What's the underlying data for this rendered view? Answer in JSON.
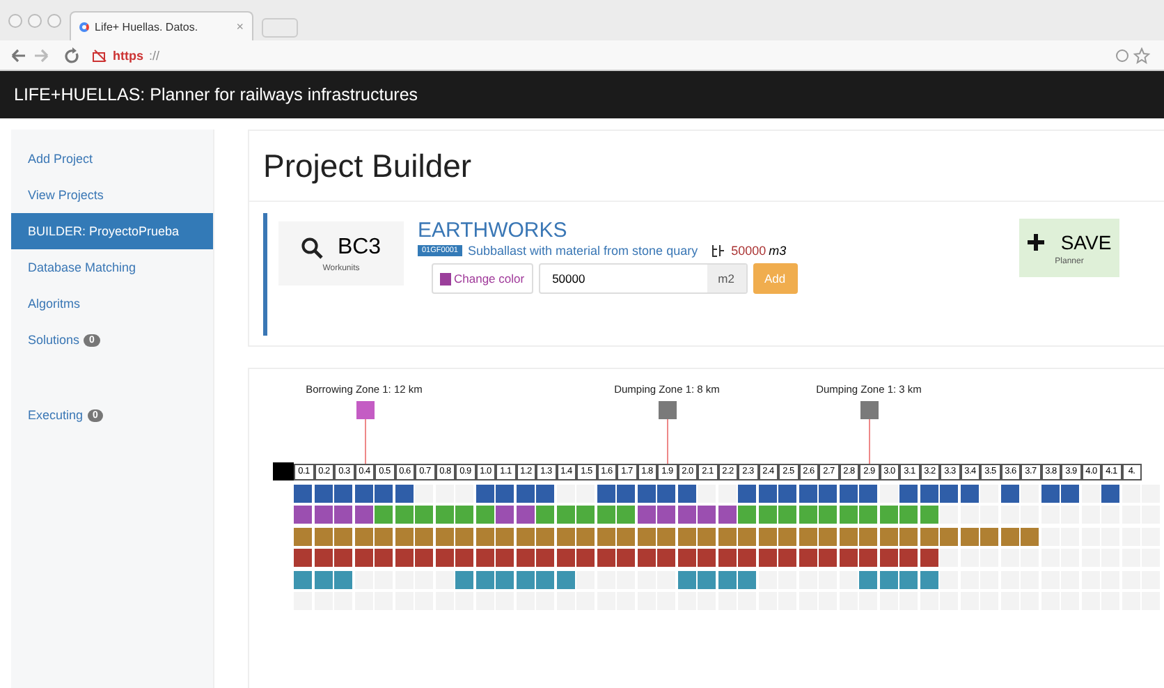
{
  "browser": {
    "tab_title": "Life+ Huellas. Datos.",
    "tab_close": "×",
    "url_scheme": "https",
    "url_rest": "://"
  },
  "navbar": {
    "title": "LIFE+HUELLAS: Planner for railways infrastructures"
  },
  "sidebar": {
    "items": [
      {
        "label": "Add Project",
        "selected": false
      },
      {
        "label": "View Projects",
        "selected": false
      },
      {
        "label": "BUILDER: ProyectoPrueba",
        "selected": true
      },
      {
        "label": "Database Matching",
        "selected": false
      },
      {
        "label": "Algoritms",
        "selected": false
      },
      {
        "label": "Solutions",
        "badge": "0",
        "selected": false
      },
      {
        "label": "Executing",
        "badge": "0",
        "selected": false,
        "separated": true
      }
    ]
  },
  "page": {
    "title": "Project Builder"
  },
  "workunit": {
    "code": "BC3",
    "caption": "Workunits",
    "category": "EARTHWORKS",
    "badge": "01GF0001",
    "description": "Subballast with material from stone quary",
    "quantity": "50000",
    "quantity_unit": "m3",
    "color": "#9b3f9b",
    "change_color": "Change color",
    "input_value": "50000",
    "input_unit": "m2",
    "add": "Add",
    "save": "SAVE",
    "save_caption": "Planner"
  },
  "timeline": {
    "labels": [
      {
        "text": "0.1"
      },
      {
        "text": "0.2"
      },
      {
        "text": "0.3"
      },
      {
        "text": "0.4",
        "marker": {
          "label": "Borrowing Zone 1: 12 km",
          "color": "#c45cc4"
        }
      },
      {
        "text": "0.5"
      },
      {
        "text": "0.6"
      },
      {
        "text": "0.7"
      },
      {
        "text": "0.8"
      },
      {
        "text": "0.9"
      },
      {
        "text": "1.0"
      },
      {
        "text": "1.1"
      },
      {
        "text": "1.2"
      },
      {
        "text": "1.3"
      },
      {
        "text": "1.4"
      },
      {
        "text": "1.5"
      },
      {
        "text": "1.6"
      },
      {
        "text": "1.7"
      },
      {
        "text": "1.8"
      },
      {
        "text": "1.9",
        "marker": {
          "label": "Dumping Zone 1: 8 km",
          "color": "#7a7a7a"
        }
      },
      {
        "text": "2.0"
      },
      {
        "text": "2.1"
      },
      {
        "text": "2.2"
      },
      {
        "text": "2.3"
      },
      {
        "text": "2.4"
      },
      {
        "text": "2.5"
      },
      {
        "text": "2.6"
      },
      {
        "text": "2.7"
      },
      {
        "text": "2.8"
      },
      {
        "text": "2.9",
        "marker": {
          "label": "Dumping Zone 1: 3 km",
          "color": "#7a7a7a"
        }
      },
      {
        "text": "3.0"
      },
      {
        "text": "3.1"
      },
      {
        "text": "3.2"
      },
      {
        "text": "3.3"
      },
      {
        "text": "3.4"
      },
      {
        "text": "3.5"
      },
      {
        "text": "3.6"
      },
      {
        "text": "3.7"
      },
      {
        "text": "3.8"
      },
      {
        "text": "3.9"
      },
      {
        "text": "4.0"
      },
      {
        "text": "4.1"
      },
      {
        "text": "4."
      }
    ],
    "rows": [
      {
        "cells": [
          {
            "filled": true,
            "color": "#2f5ea8"
          },
          {
            "filled": true,
            "color": "#2f5ea8"
          },
          {
            "filled": true,
            "color": "#2f5ea8"
          },
          {
            "filled": true,
            "color": "#2f5ea8"
          },
          {
            "filled": true,
            "color": "#2f5ea8"
          },
          {
            "filled": true,
            "color": "#2f5ea8"
          },
          {
            "filled": false
          },
          {
            "filled": false
          },
          {
            "filled": false
          },
          {
            "filled": true,
            "color": "#2f5ea8"
          },
          {
            "filled": true,
            "color": "#2f5ea8"
          },
          {
            "filled": true,
            "color": "#2f5ea8"
          },
          {
            "filled": true,
            "color": "#2f5ea8"
          },
          {
            "filled": false
          },
          {
            "filled": false
          },
          {
            "filled": true,
            "color": "#2f5ea8"
          },
          {
            "filled": true,
            "color": "#2f5ea8"
          },
          {
            "filled": true,
            "color": "#2f5ea8"
          },
          {
            "filled": true,
            "color": "#2f5ea8"
          },
          {
            "filled": true,
            "color": "#2f5ea8"
          },
          {
            "filled": false
          },
          {
            "filled": false
          },
          {
            "filled": true,
            "color": "#2f5ea8"
          },
          {
            "filled": true,
            "color": "#2f5ea8"
          },
          {
            "filled": true,
            "color": "#2f5ea8"
          },
          {
            "filled": true,
            "color": "#2f5ea8"
          },
          {
            "filled": true,
            "color": "#2f5ea8"
          },
          {
            "filled": true,
            "color": "#2f5ea8"
          },
          {
            "filled": true,
            "color": "#2f5ea8"
          },
          {
            "filled": false
          },
          {
            "filled": true,
            "color": "#2f5ea8"
          },
          {
            "filled": true,
            "color": "#2f5ea8"
          },
          {
            "filled": true,
            "color": "#2f5ea8"
          },
          {
            "filled": true,
            "color": "#2f5ea8"
          },
          {
            "filled": false
          },
          {
            "filled": true,
            "color": "#2f5ea8"
          },
          {
            "filled": false
          },
          {
            "filled": true,
            "color": "#2f5ea8"
          },
          {
            "filled": true,
            "color": "#2f5ea8"
          },
          {
            "filled": false
          },
          {
            "filled": true,
            "color": "#2f5ea8"
          },
          {
            "filled": false
          },
          {
            "filled": false
          }
        ]
      },
      {
        "cells": [
          {
            "filled": true,
            "color": "#9b4fb0"
          },
          {
            "filled": true,
            "color": "#9b4fb0"
          },
          {
            "filled": true,
            "color": "#9b4fb0"
          },
          {
            "filled": true,
            "color": "#9b4fb0"
          },
          {
            "filled": true,
            "color": "#4eac3e"
          },
          {
            "filled": true,
            "color": "#4eac3e"
          },
          {
            "filled": true,
            "color": "#4eac3e"
          },
          {
            "filled": true,
            "color": "#4eac3e"
          },
          {
            "filled": true,
            "color": "#4eac3e"
          },
          {
            "filled": true,
            "color": "#4eac3e"
          },
          {
            "filled": true,
            "color": "#9b4fb0"
          },
          {
            "filled": true,
            "color": "#9b4fb0"
          },
          {
            "filled": true,
            "color": "#4eac3e"
          },
          {
            "filled": true,
            "color": "#4eac3e"
          },
          {
            "filled": true,
            "color": "#4eac3e"
          },
          {
            "filled": true,
            "color": "#4eac3e"
          },
          {
            "filled": true,
            "color": "#4eac3e"
          },
          {
            "filled": true,
            "color": "#9b4fb0"
          },
          {
            "filled": true,
            "color": "#9b4fb0"
          },
          {
            "filled": true,
            "color": "#9b4fb0"
          },
          {
            "filled": true,
            "color": "#9b4fb0"
          },
          {
            "filled": true,
            "color": "#9b4fb0"
          },
          {
            "filled": true,
            "color": "#4eac3e"
          },
          {
            "filled": true,
            "color": "#4eac3e"
          },
          {
            "filled": true,
            "color": "#4eac3e"
          },
          {
            "filled": true,
            "color": "#4eac3e"
          },
          {
            "filled": true,
            "color": "#4eac3e"
          },
          {
            "filled": true,
            "color": "#4eac3e"
          },
          {
            "filled": true,
            "color": "#4eac3e"
          },
          {
            "filled": true,
            "color": "#4eac3e"
          },
          {
            "filled": true,
            "color": "#4eac3e"
          },
          {
            "filled": true,
            "color": "#4eac3e"
          },
          {
            "filled": false
          },
          {
            "filled": false
          },
          {
            "filled": false
          },
          {
            "filled": false
          },
          {
            "filled": false
          },
          {
            "filled": false
          },
          {
            "filled": false
          },
          {
            "filled": false
          },
          {
            "filled": false
          },
          {
            "filled": false
          },
          {
            "filled": false
          }
        ]
      },
      {
        "cells": [
          {
            "filled": true,
            "color": "#b08032"
          },
          {
            "filled": true,
            "color": "#b08032"
          },
          {
            "filled": true,
            "color": "#b08032"
          },
          {
            "filled": true,
            "color": "#b08032"
          },
          {
            "filled": true,
            "color": "#b08032"
          },
          {
            "filled": true,
            "color": "#b08032"
          },
          {
            "filled": true,
            "color": "#b08032"
          },
          {
            "filled": true,
            "color": "#b08032"
          },
          {
            "filled": true,
            "color": "#b08032"
          },
          {
            "filled": true,
            "color": "#b08032"
          },
          {
            "filled": true,
            "color": "#b08032"
          },
          {
            "filled": true,
            "color": "#b08032"
          },
          {
            "filled": true,
            "color": "#b08032"
          },
          {
            "filled": true,
            "color": "#b08032"
          },
          {
            "filled": true,
            "color": "#b08032"
          },
          {
            "filled": true,
            "color": "#b08032"
          },
          {
            "filled": true,
            "color": "#b08032"
          },
          {
            "filled": true,
            "color": "#b08032"
          },
          {
            "filled": true,
            "color": "#b08032"
          },
          {
            "filled": true,
            "color": "#b08032"
          },
          {
            "filled": true,
            "color": "#b08032"
          },
          {
            "filled": true,
            "color": "#b08032"
          },
          {
            "filled": true,
            "color": "#b08032"
          },
          {
            "filled": true,
            "color": "#b08032"
          },
          {
            "filled": true,
            "color": "#b08032"
          },
          {
            "filled": true,
            "color": "#b08032"
          },
          {
            "filled": true,
            "color": "#b08032"
          },
          {
            "filled": true,
            "color": "#b08032"
          },
          {
            "filled": true,
            "color": "#b08032"
          },
          {
            "filled": true,
            "color": "#b08032"
          },
          {
            "filled": true,
            "color": "#b08032"
          },
          {
            "filled": true,
            "color": "#b08032"
          },
          {
            "filled": true,
            "color": "#b08032"
          },
          {
            "filled": true,
            "color": "#b08032"
          },
          {
            "filled": true,
            "color": "#b08032"
          },
          {
            "filled": true,
            "color": "#b08032"
          },
          {
            "filled": true,
            "color": "#b08032"
          },
          {
            "filled": false
          },
          {
            "filled": false
          },
          {
            "filled": false
          },
          {
            "filled": false
          },
          {
            "filled": false
          },
          {
            "filled": false
          }
        ]
      },
      {
        "cells": [
          {
            "filled": true,
            "color": "#ad3a31"
          },
          {
            "filled": true,
            "color": "#ad3a31"
          },
          {
            "filled": true,
            "color": "#ad3a31"
          },
          {
            "filled": true,
            "color": "#ad3a31"
          },
          {
            "filled": true,
            "color": "#ad3a31"
          },
          {
            "filled": true,
            "color": "#ad3a31"
          },
          {
            "filled": true,
            "color": "#ad3a31"
          },
          {
            "filled": true,
            "color": "#ad3a31"
          },
          {
            "filled": true,
            "color": "#ad3a31"
          },
          {
            "filled": true,
            "color": "#ad3a31"
          },
          {
            "filled": true,
            "color": "#ad3a31"
          },
          {
            "filled": true,
            "color": "#ad3a31"
          },
          {
            "filled": true,
            "color": "#ad3a31"
          },
          {
            "filled": true,
            "color": "#ad3a31"
          },
          {
            "filled": true,
            "color": "#ad3a31"
          },
          {
            "filled": true,
            "color": "#ad3a31"
          },
          {
            "filled": true,
            "color": "#ad3a31"
          },
          {
            "filled": true,
            "color": "#ad3a31"
          },
          {
            "filled": true,
            "color": "#ad3a31"
          },
          {
            "filled": true,
            "color": "#ad3a31"
          },
          {
            "filled": true,
            "color": "#ad3a31"
          },
          {
            "filled": true,
            "color": "#ad3a31"
          },
          {
            "filled": true,
            "color": "#ad3a31"
          },
          {
            "filled": true,
            "color": "#ad3a31"
          },
          {
            "filled": true,
            "color": "#ad3a31"
          },
          {
            "filled": true,
            "color": "#ad3a31"
          },
          {
            "filled": true,
            "color": "#ad3a31"
          },
          {
            "filled": true,
            "color": "#ad3a31"
          },
          {
            "filled": true,
            "color": "#ad3a31"
          },
          {
            "filled": true,
            "color": "#ad3a31"
          },
          {
            "filled": true,
            "color": "#ad3a31"
          },
          {
            "filled": true,
            "color": "#ad3a31"
          },
          {
            "filled": false
          },
          {
            "filled": false
          },
          {
            "filled": false
          },
          {
            "filled": false
          },
          {
            "filled": false
          },
          {
            "filled": false
          },
          {
            "filled": false
          },
          {
            "filled": false
          },
          {
            "filled": false
          },
          {
            "filled": false
          },
          {
            "filled": false
          }
        ]
      },
      {
        "cells": [
          {
            "filled": true,
            "color": "#3d95b0"
          },
          {
            "filled": true,
            "color": "#3d95b0"
          },
          {
            "filled": true,
            "color": "#3d95b0"
          },
          {
            "filled": false
          },
          {
            "filled": false
          },
          {
            "filled": false
          },
          {
            "filled": false
          },
          {
            "filled": false
          },
          {
            "filled": true,
            "color": "#3d95b0"
          },
          {
            "filled": true,
            "color": "#3d95b0"
          },
          {
            "filled": true,
            "color": "#3d95b0"
          },
          {
            "filled": true,
            "color": "#3d95b0"
          },
          {
            "filled": true,
            "color": "#3d95b0"
          },
          {
            "filled": true,
            "color": "#3d95b0"
          },
          {
            "filled": false
          },
          {
            "filled": false
          },
          {
            "filled": false
          },
          {
            "filled": false
          },
          {
            "filled": false
          },
          {
            "filled": true,
            "color": "#3d95b0"
          },
          {
            "filled": true,
            "color": "#3d95b0"
          },
          {
            "filled": true,
            "color": "#3d95b0"
          },
          {
            "filled": true,
            "color": "#3d95b0"
          },
          {
            "filled": false
          },
          {
            "filled": false
          },
          {
            "filled": false
          },
          {
            "filled": false
          },
          {
            "filled": false
          },
          {
            "filled": true,
            "color": "#3d95b0"
          },
          {
            "filled": true,
            "color": "#3d95b0"
          },
          {
            "filled": true,
            "color": "#3d95b0"
          },
          {
            "filled": true,
            "color": "#3d95b0"
          },
          {
            "filled": false
          },
          {
            "filled": false
          },
          {
            "filled": false
          },
          {
            "filled": false
          },
          {
            "filled": false
          },
          {
            "filled": false
          },
          {
            "filled": false
          },
          {
            "filled": false
          },
          {
            "filled": false
          },
          {
            "filled": false
          },
          {
            "filled": false
          }
        ]
      },
      {
        "cells": [
          {
            "filled": false
          },
          {
            "filled": false
          },
          {
            "filled": false
          },
          {
            "filled": false
          },
          {
            "filled": false
          },
          {
            "filled": false
          },
          {
            "filled": false
          },
          {
            "filled": false
          },
          {
            "filled": false
          },
          {
            "filled": false
          },
          {
            "filled": false
          },
          {
            "filled": false
          },
          {
            "filled": false
          },
          {
            "filled": false
          },
          {
            "filled": false
          },
          {
            "filled": false
          },
          {
            "filled": false
          },
          {
            "filled": false
          },
          {
            "filled": false
          },
          {
            "filled": false
          },
          {
            "filled": false
          },
          {
            "filled": false
          },
          {
            "filled": false
          },
          {
            "filled": false
          },
          {
            "filled": false
          },
          {
            "filled": false
          },
          {
            "filled": false
          },
          {
            "filled": false
          },
          {
            "filled": false
          },
          {
            "filled": false
          },
          {
            "filled": false
          },
          {
            "filled": false
          },
          {
            "filled": false
          },
          {
            "filled": false
          },
          {
            "filled": false
          },
          {
            "filled": false
          },
          {
            "filled": false
          },
          {
            "filled": false
          },
          {
            "filled": false
          },
          {
            "filled": false
          },
          {
            "filled": false
          },
          {
            "filled": false
          },
          {
            "filled": false
          }
        ]
      }
    ]
  }
}
